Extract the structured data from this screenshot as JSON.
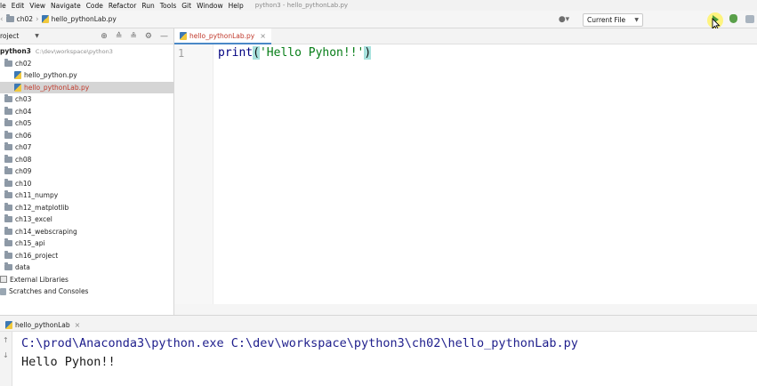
{
  "menu": [
    "le",
    "Edit",
    "View",
    "Navigate",
    "Code",
    "Refactor",
    "Run",
    "Tools",
    "Git",
    "Window",
    "Help"
  ],
  "window_title": "python3 - hello_pythonLab.py",
  "nav": {
    "breadcrumb": "ch02",
    "file": "hello_pythonLab.py",
    "run_config": "Current File"
  },
  "project": {
    "header": "roject",
    "root": {
      "name": "python3",
      "path": "C:\\dev\\workspace\\python3"
    },
    "items": [
      {
        "label": "ch02"
      },
      {
        "label": "hello_python.py"
      },
      {
        "label": "hello_pythonLab.py"
      },
      {
        "label": "ch03"
      },
      {
        "label": "ch04"
      },
      {
        "label": "ch05"
      },
      {
        "label": "ch06"
      },
      {
        "label": "ch07"
      },
      {
        "label": "ch08"
      },
      {
        "label": "ch09"
      },
      {
        "label": "ch10"
      },
      {
        "label": "ch11_numpy"
      },
      {
        "label": "ch12_matplotlib"
      },
      {
        "label": "ch13_excel"
      },
      {
        "label": "ch14_webscraping"
      },
      {
        "label": "ch15_api"
      },
      {
        "label": "ch16_project"
      },
      {
        "label": "data"
      },
      {
        "label": "External Libraries"
      },
      {
        "label": "Scratches and Consoles"
      }
    ]
  },
  "editor": {
    "tab": "hello_pythonLab.py",
    "line_number": "1",
    "code": {
      "func": "print",
      "open": "(",
      "string": "'Hello Pyhon!!'",
      "close": ")"
    }
  },
  "run": {
    "tab": "hello_pythonLab",
    "command": "C:\\prod\\Anaconda3\\python.exe C:\\dev\\workspace\\python3\\ch02\\hello_pythonLab.py",
    "output": "Hello Pyhon!!"
  },
  "colors": {
    "accent": "#4a88c7",
    "python_file": "#c0392b",
    "run_green": "#4a9a3a",
    "bracket_highlight": "#a8e2de"
  }
}
